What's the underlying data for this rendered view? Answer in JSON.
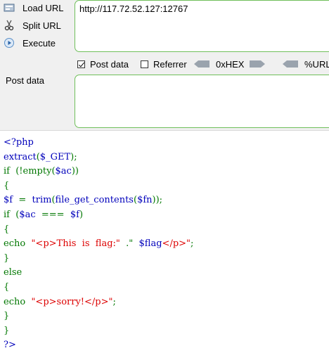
{
  "toolbar": {
    "load_url": "Load URL",
    "split_url": "Split URL",
    "execute": "Execute"
  },
  "url_field": {
    "value": "http://117.72.52.127:12767"
  },
  "options": {
    "post_data": {
      "label": "Post data",
      "checked": true
    },
    "referrer": {
      "label": "Referrer",
      "checked": false
    },
    "hex": {
      "label": "0xHEX"
    },
    "urlenc": {
      "label": "%URL"
    }
  },
  "post_section": {
    "label": "Post data",
    "value": ""
  },
  "code": {
    "lines": [
      [
        {
          "t": "<?php",
          "c": "def"
        }
      ],
      [
        {
          "t": "extract",
          "c": "def"
        },
        {
          "t": "(",
          "c": "kw"
        },
        {
          "t": "$_GET",
          "c": "def"
        },
        {
          "t": ");",
          "c": "kw"
        }
      ],
      [
        {
          "t": "if  (!",
          "c": "kw"
        },
        {
          "t": "empty",
          "c": "kw"
        },
        {
          "t": "(",
          "c": "kw"
        },
        {
          "t": "$ac",
          "c": "def"
        },
        {
          "t": "))",
          "c": "kw"
        }
      ],
      [
        {
          "t": "{",
          "c": "kw"
        }
      ],
      [
        {
          "t": "$f  ",
          "c": "def"
        },
        {
          "t": "=  ",
          "c": "kw"
        },
        {
          "t": "trim",
          "c": "def"
        },
        {
          "t": "(",
          "c": "kw"
        },
        {
          "t": "file_get_contents",
          "c": "def"
        },
        {
          "t": "(",
          "c": "kw"
        },
        {
          "t": "$fn",
          "c": "def"
        },
        {
          "t": "));",
          "c": "kw"
        }
      ],
      [
        {
          "t": "if  (",
          "c": "kw"
        },
        {
          "t": "$ac  ",
          "c": "def"
        },
        {
          "t": "===  ",
          "c": "kw"
        },
        {
          "t": "$f",
          "c": "def"
        },
        {
          "t": ")",
          "c": "kw"
        }
      ],
      [
        {
          "t": "{",
          "c": "kw"
        }
      ],
      [
        {
          "t": "echo  ",
          "c": "kw"
        },
        {
          "t": "\"<p>This  is  flag:\"  ",
          "c": "str"
        },
        {
          "t": ".\"  ",
          "c": "kw"
        },
        {
          "t": "$flag",
          "c": "def"
        },
        {
          "t": "</p>\"",
          "c": "str"
        },
        {
          "t": ";",
          "c": "kw"
        }
      ],
      [
        {
          "t": "}",
          "c": "kw"
        }
      ],
      [
        {
          "t": "else",
          "c": "kw"
        }
      ],
      [
        {
          "t": "{",
          "c": "kw"
        }
      ],
      [
        {
          "t": "echo  ",
          "c": "kw"
        },
        {
          "t": "\"<p>sorry!</p>\"",
          "c": "str"
        },
        {
          "t": ";",
          "c": "kw"
        }
      ],
      [
        {
          "t": "}",
          "c": "kw"
        }
      ],
      [
        {
          "t": "}",
          "c": "kw"
        }
      ],
      [
        {
          "t": "?>",
          "c": "def"
        }
      ]
    ]
  }
}
